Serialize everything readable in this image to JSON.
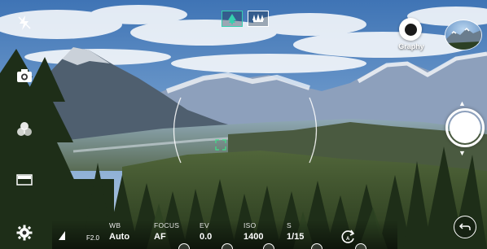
{
  "lens_toggle": {
    "standard_icon": "single-tree-icon",
    "wide_icon": "group-of-people-icon",
    "active": "standard"
  },
  "left_rail": [
    "flash-off-icon",
    "camera-mode-icon",
    "filter-icon",
    "gallery-strip-icon",
    "settings-icon"
  ],
  "graphy": {
    "label": "Graphy",
    "icon": "graphy-icon"
  },
  "manual_controls": {
    "aperture": "F2.0",
    "items": [
      {
        "label": "WB",
        "value": "Auto"
      },
      {
        "label": "FOCUS",
        "value": "AF"
      },
      {
        "label": "EV",
        "value": "0.0"
      },
      {
        "label": "ISO",
        "value": "1400"
      },
      {
        "label": "S",
        "value": "1/15"
      }
    ]
  },
  "colors": {
    "lens_active": "#35d0ae",
    "focus_point": "#3fe08a",
    "overlay_text": "#ffffff"
  }
}
